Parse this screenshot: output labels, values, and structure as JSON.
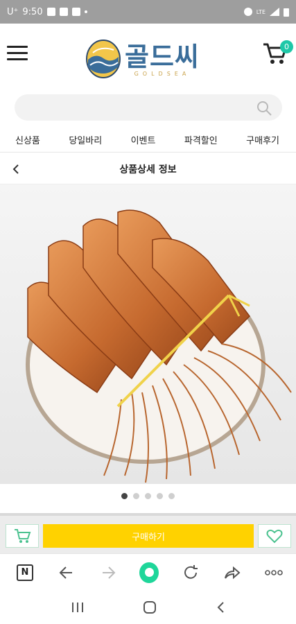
{
  "status": {
    "carrier": "U⁺",
    "time": "9:50",
    "network": "LTE"
  },
  "header": {
    "logo_main": "골드씨",
    "logo_sub": "GOLDSEA",
    "cart_count": "0"
  },
  "search": {
    "placeholder": ""
  },
  "nav": {
    "items": [
      "신상품",
      "당일바리",
      "이벤트",
      "파격할인",
      "구매후기"
    ]
  },
  "subheader": {
    "title": "상품상세 정보"
  },
  "gallery": {
    "total": 5,
    "active_index": 0
  },
  "actions": {
    "buy_label": "구매하기"
  },
  "colors": {
    "accent_yellow": "#ffd200",
    "badge_teal": "#1ec8a8",
    "logo_blue": "#3a6d9a",
    "browser_green": "#1fd69a"
  }
}
